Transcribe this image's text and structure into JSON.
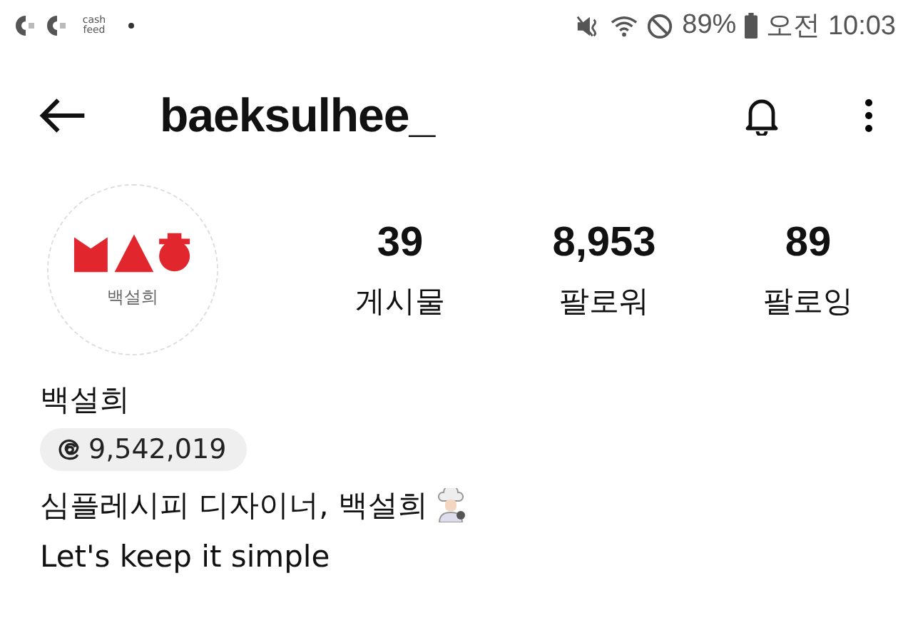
{
  "status_bar": {
    "app_label": "cash feed",
    "battery": "89%",
    "time": "오전 10:03"
  },
  "header": {
    "username": "baeksulhee_"
  },
  "profile": {
    "avatar_caption": "백설희",
    "stats": [
      {
        "value": "39",
        "label": "게시물"
      },
      {
        "value": "8,953",
        "label": "팔로워"
      },
      {
        "value": "89",
        "label": "팔로잉"
      }
    ],
    "name": "백설희",
    "threads_count": "9,542,019",
    "bio": [
      "심플레시피 디자이너, 백설희",
      "Let's keep it simple"
    ]
  }
}
